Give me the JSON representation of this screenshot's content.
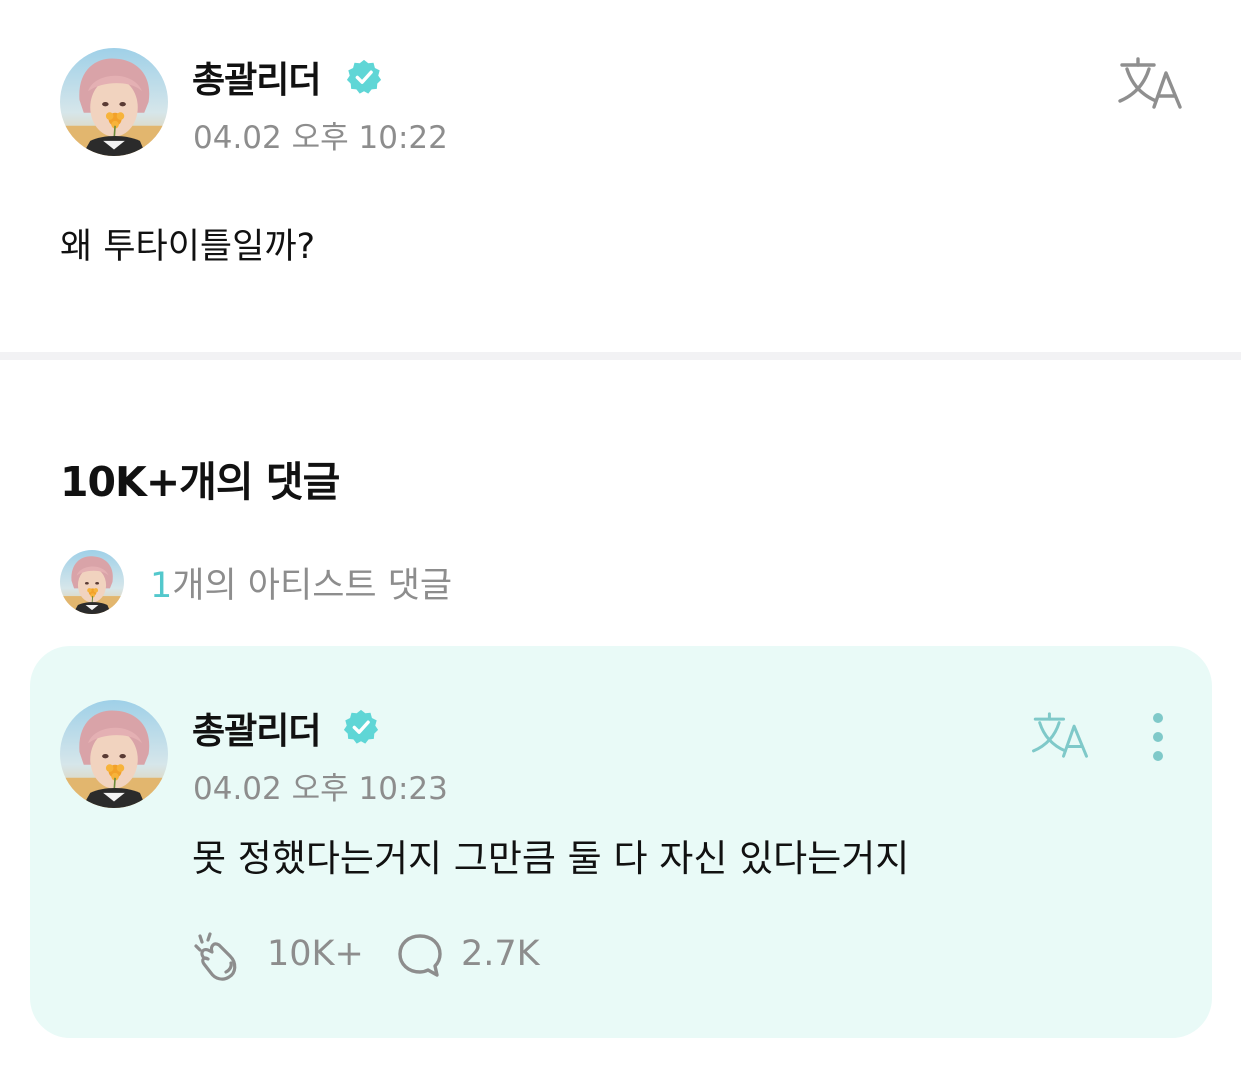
{
  "post": {
    "author": "총괄리더",
    "timestamp": "04.02 오후 10:22",
    "body": "왜 투타이틀일까?",
    "translate_icon": "translate-icon",
    "verified_icon": "verified-badge-icon"
  },
  "comments_section": {
    "heading": "10K+개의 댓글",
    "artist_filter": {
      "count": "1",
      "label": "개의 아티스트 댓글"
    }
  },
  "comment": {
    "author": "총괄리더",
    "timestamp": "04.02 오후 10:23",
    "text": "못 정했다는거지 그만큼 둘 다 자신 있다는거지",
    "likes": "10K+",
    "replies": "2.7K",
    "like_icon": "cheer-icon",
    "reply_icon": "speech-bubble-icon",
    "more_icon": "more-vertical-icon"
  },
  "colors": {
    "accent": "#53c8cc",
    "verified": "#5fd6d6",
    "card_background": "#e9faf7",
    "muted_text": "#8d8d8d",
    "divider": "#f2f2f4"
  }
}
